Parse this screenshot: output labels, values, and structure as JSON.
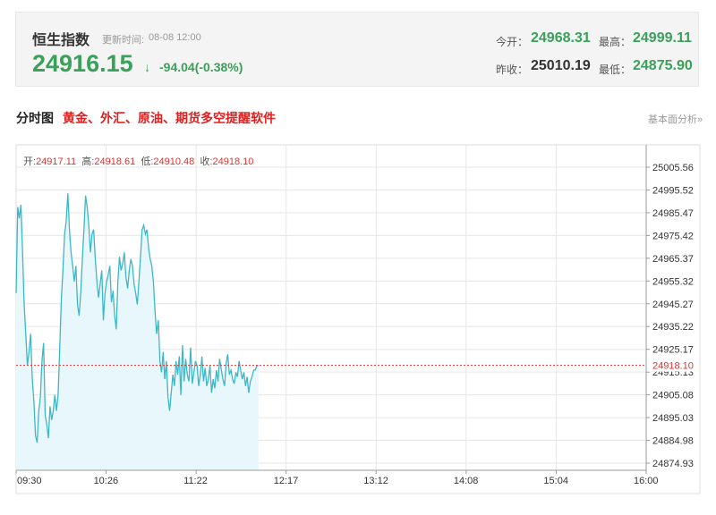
{
  "header": {
    "index_name": "恒生指数",
    "update_label": "更新时间:",
    "update_time": "08-08 12:00",
    "price": "24916.15",
    "arrow": "↓",
    "change": "-94.04(-0.38%)",
    "open_label": "今开：",
    "open_value": "24968.31",
    "high_label": "最高：",
    "high_value": "24999.11",
    "prev_close_label": "昨收：",
    "prev_close_value": "25010.19",
    "low_label": "最低：",
    "low_value": "24875.90"
  },
  "section": {
    "title": "分时图",
    "promo_link": "黄金、外汇、原油、期货多空提醒软件",
    "fundamental_link": "基本面分析»"
  },
  "ohlc_bar": {
    "open_label": "开:",
    "open": "24917.11",
    "high_label": "高:",
    "high": "24918.61",
    "low_label": "低:",
    "low": "24910.48",
    "close_label": "收:",
    "close": "24918.10"
  },
  "colors": {
    "line": "#3cb8c8",
    "fill": "#e8f7fb",
    "grid": "#e6e6e6",
    "price_line": "#e03030",
    "up_green": "#3aa05a"
  },
  "chart_data": {
    "type": "area",
    "title": "",
    "xlabel": "",
    "ylabel": "",
    "x_ticks": [
      "09:30",
      "10:26",
      "11:22",
      "12:17",
      "13:12",
      "14:08",
      "15:04",
      "16:00"
    ],
    "y_ticks": [
      "25005.56",
      "24995.52",
      "24985.47",
      "24975.42",
      "24965.37",
      "24955.32",
      "24945.27",
      "24935.22",
      "24925.17",
      "24915.13",
      "24905.08",
      "24895.03",
      "24884.98",
      "24874.93"
    ],
    "ylim": [
      24874.93,
      25005.56
    ],
    "current_price": "24918.10",
    "x_minutes": [
      0,
      1,
      2,
      3,
      4,
      5,
      6,
      7,
      8,
      9,
      10,
      11,
      12,
      13,
      14,
      15,
      16,
      17,
      18,
      19,
      20,
      21,
      22,
      23,
      24,
      25,
      26,
      27,
      28,
      29,
      30,
      31,
      32,
      33,
      34,
      35,
      36,
      37,
      38,
      39,
      40,
      41,
      42,
      43,
      44,
      45,
      46,
      47,
      48,
      49,
      50,
      51,
      52,
      53,
      54,
      55,
      56,
      57,
      58,
      59,
      60,
      61,
      62,
      63,
      64,
      65,
      66,
      67,
      68,
      69,
      70,
      71,
      72,
      73,
      74,
      75,
      76,
      77,
      78,
      79,
      80,
      81,
      82,
      83,
      84,
      85,
      86,
      87,
      88,
      89,
      90,
      91,
      92,
      93,
      94,
      95,
      96,
      97,
      98,
      99,
      100,
      101,
      102,
      103,
      104,
      105,
      106,
      107,
      108,
      109,
      110,
      111,
      112,
      113,
      114,
      115,
      116,
      117,
      118,
      119,
      120,
      121,
      122,
      123,
      124,
      125,
      126,
      127,
      128,
      129,
      130,
      131,
      132,
      133,
      134,
      135,
      136,
      137,
      138,
      139,
      140,
      141,
      142,
      143,
      144,
      145,
      146,
      147,
      148,
      149,
      150
    ],
    "values": [
      24950,
      24988,
      24983,
      24989,
      24968,
      24945,
      24932,
      24918,
      24924,
      24932,
      24912,
      24902,
      24887,
      24884,
      24898,
      24904,
      24920,
      24928,
      24896,
      24892,
      24886,
      24900,
      24894,
      24898,
      24905,
      24898,
      24905,
      24925,
      24947,
      24960,
      24976,
      24982,
      24994,
      24978,
      24968,
      24962,
      24955,
      24962,
      24945,
      24940,
      24950,
      24965,
      24978,
      24993,
      24988,
      24980,
      24968,
      24976,
      24978,
      24965,
      24955,
      24948,
      24954,
      24960,
      24938,
      24950,
      24955,
      24958,
      24962,
      24946,
      24951,
      24940,
      24934,
      24955,
      24966,
      24960,
      24963,
      24968,
      24957,
      24952,
      24960,
      24965,
      24962,
      24954,
      24950,
      24945,
      24955,
      24966,
      24978,
      24980,
      24976,
      24978,
      24970,
      24965,
      24962,
      24955,
      24942,
      24932,
      24938,
      24920,
      24915,
      24924,
      24912,
      24920,
      24904,
      24898,
      24906,
      24914,
      24909,
      24920,
      24914,
      24922,
      24905,
      24927,
      24911,
      24921,
      24914,
      24911,
      24926,
      24910,
      24915,
      24920,
      24918,
      24909,
      24914,
      24922,
      24911,
      24917,
      24909,
      24912,
      24918,
      24906,
      24912,
      24908,
      24916,
      24911,
      24921,
      24916,
      24912,
      24909,
      24919,
      24923,
      24914,
      24916,
      24912,
      24910,
      24915,
      24913,
      24920,
      24916,
      24912,
      24915,
      24909,
      24913,
      24906,
      24911,
      24913,
      24916,
      24916,
      24918,
      24918
    ]
  }
}
